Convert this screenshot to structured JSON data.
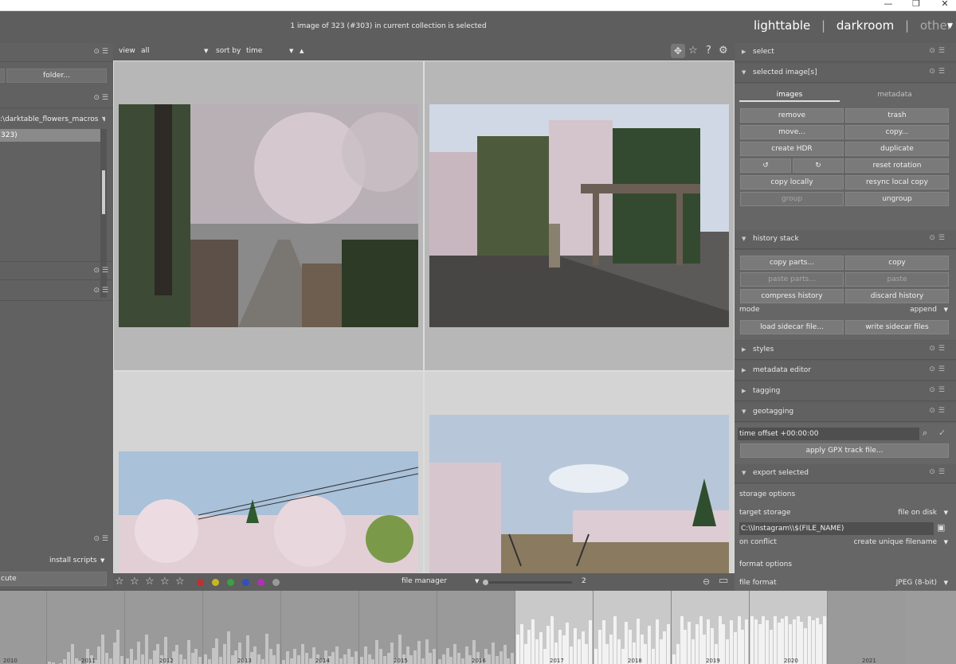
{
  "window": {
    "minimize": "—",
    "maximize": "❐",
    "close": "✕"
  },
  "header": {
    "info": "1 image of 323 (#303) in current collection is selected",
    "views": [
      "lighttable",
      "darkroom",
      "other"
    ],
    "separator": "|",
    "active_view": "lighttable",
    "collapse_icon": "triangle-down-icon"
  },
  "left_panel": {
    "folder_button": "folder...",
    "path": ":\\darktable_flowers_macros",
    "count": "323)",
    "install_scripts": "install scripts",
    "execute": "cute"
  },
  "toolbar": {
    "view_label": "view",
    "view_value": "all",
    "sort_label": "sort by",
    "sort_value": "time",
    "icons": [
      "grid-icon",
      "star-icon",
      "help-icon",
      "gear-icon"
    ]
  },
  "bottom_bar": {
    "stars": [
      "☆",
      "☆",
      "☆",
      "☆",
      "☆"
    ],
    "color_labels": [
      "#c03030",
      "#c8b820",
      "#3aa040",
      "#3050c0",
      "#b030b8",
      "#9a9a9a"
    ],
    "layout_mode": "file manager",
    "zoom_value": "2"
  },
  "right_panel": {
    "select": "select",
    "selected_images": "selected image[s]",
    "tabs": [
      "images",
      "metadata"
    ],
    "image_buttons": [
      [
        "remove",
        "trash"
      ],
      [
        "move...",
        "copy..."
      ],
      [
        "create HDR",
        "duplicate"
      ],
      [
        "↺",
        "↻",
        "reset rotation"
      ],
      [
        "copy locally",
        "resync local copy"
      ],
      [
        "group",
        "ungroup"
      ]
    ],
    "history_stack": "history stack",
    "history_buttons": [
      [
        "copy parts...",
        "copy"
      ],
      [
        "paste parts...",
        "paste"
      ],
      [
        "compress history",
        "discard history"
      ]
    ],
    "mode_label": "mode",
    "mode_value": "append",
    "sidecar_buttons": [
      "load sidecar file...",
      "write sidecar files"
    ],
    "styles": "styles",
    "metadata_editor": "metadata editor",
    "tagging": "tagging",
    "geotagging": "geotagging",
    "time_offset_label": "time offset",
    "time_offset_value": "+00:00:00",
    "apply_gpx": "apply GPX track file...",
    "export_selected": "export selected",
    "storage_options": "storage options",
    "target_storage_label": "target storage",
    "target_storage_value": "file on disk",
    "path_value": "C:\\\\Instagram\\\\$(FILE_NAME)",
    "on_conflict_label": "on conflict",
    "on_conflict_value": "create unique filename",
    "format_options": "format options",
    "file_format_label": "file format",
    "file_format_value": "JPEG (8-bit)"
  },
  "timeline": {
    "years": [
      "2010",
      "2011",
      "2012",
      "2013",
      "2014",
      "2015",
      "2016",
      "2017",
      "2018",
      "2019",
      "2020",
      "2021"
    ]
  }
}
